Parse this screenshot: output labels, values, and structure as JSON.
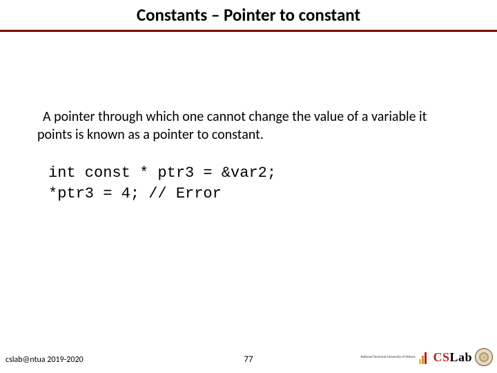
{
  "title": "Constants – Pointer to constant",
  "paragraph": "A pointer through which one cannot change the value of a variable it points is known as a pointer to constant.",
  "code": {
    "line1": "int const * ptr3 = &var2;",
    "line2": "*ptr3 = 4; // Error"
  },
  "footer": {
    "left": "cslab@ntua 2019-2020",
    "page": "77",
    "uni": "National Technical University of Athens",
    "logo": {
      "cs": "CS",
      "lab": "Lab"
    }
  }
}
